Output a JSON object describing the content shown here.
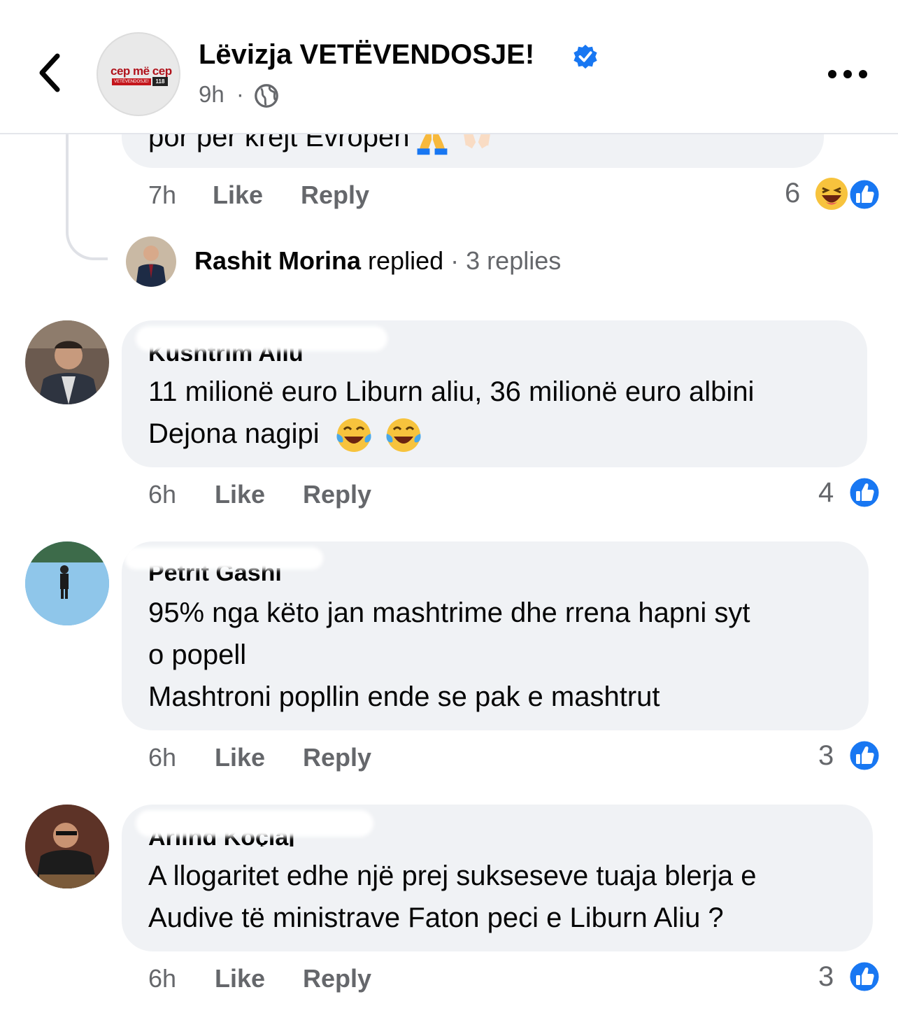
{
  "header": {
    "page_name": "Lëvizja VETËVENDOSJE!",
    "time": "9h",
    "separator": "·",
    "logo_text": "cep më cep",
    "logo_strip": "VETËVENDOSJE!",
    "logo_number": "118"
  },
  "prev_comment": {
    "text_fragment": "por per krejt Evropen",
    "time": "7h",
    "like": "Like",
    "reply": "Reply",
    "reaction_count": "6"
  },
  "replied_row": {
    "name": "Rashit Morina",
    "action": "replied",
    "separator": "·",
    "replies": "3 replies"
  },
  "comments": [
    {
      "author": "Kushtrim Aliu",
      "lines": [
        "11 milionë euro Liburn aliu, 36 milionë euro albini",
        "Dejona nagipi"
      ],
      "time": "6h",
      "like": "Like",
      "reply": "Reply",
      "reaction_count": "4"
    },
    {
      "author": "Petrit Gashi",
      "lines": [
        "95% nga këto jan mashtrime dhe rrena hapni syt",
        "o popell",
        "Mashtroni popllin ende se pak e mashtrut"
      ],
      "time": "6h",
      "like": "Like",
      "reply": "Reply",
      "reaction_count": "3"
    },
    {
      "author": "Arlind Koçiaj",
      "lines": [
        "A llogaritet edhe një prej sukseseve tuaja blerja e",
        "Audive të ministrave Faton peci e Liburn Aliu ?"
      ],
      "time": "6h",
      "like": "Like",
      "reply": "Reply",
      "reaction_count": "3"
    }
  ],
  "colors": {
    "accent": "#1877f2",
    "secondary_text": "#65676b",
    "bubble": "#f0f2f5"
  },
  "icons": [
    "back-arrow-icon",
    "verified-badge-icon",
    "globe-icon",
    "more-icon",
    "like-reaction-icon",
    "haha-reaction-icon",
    "praying-hands-emoji",
    "joy-emoji"
  ]
}
